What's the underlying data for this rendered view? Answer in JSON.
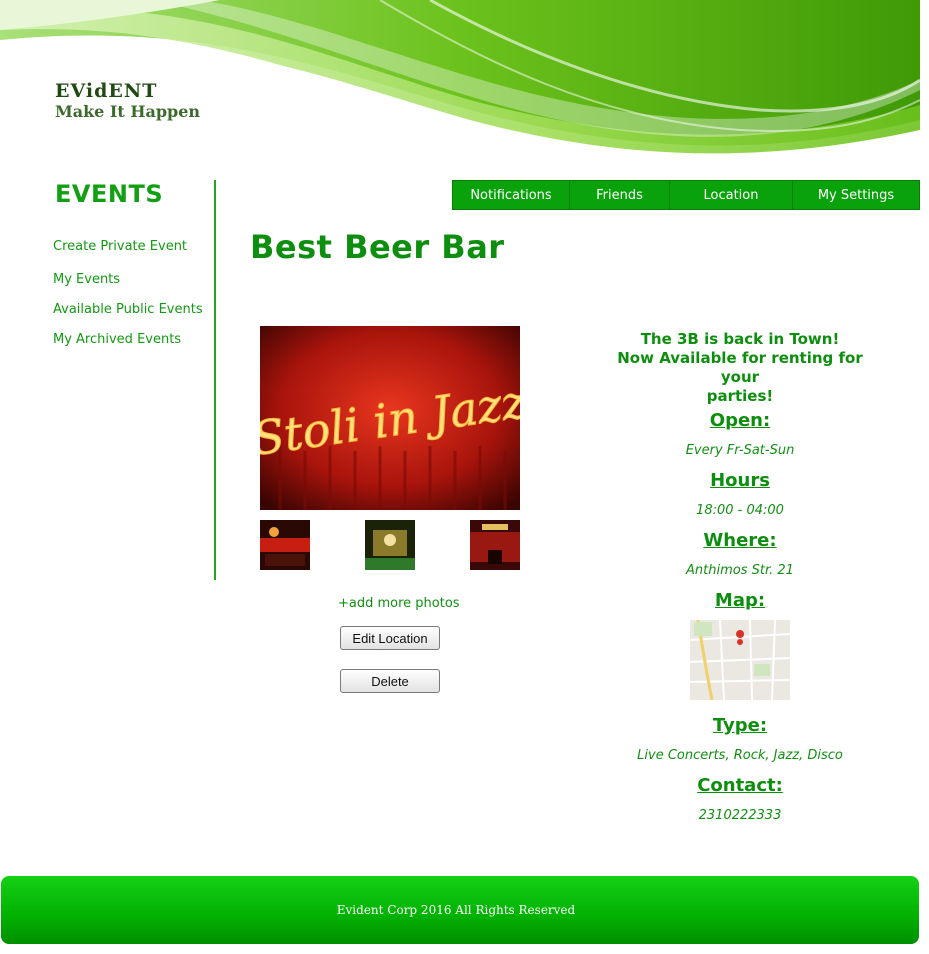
{
  "brand": {
    "name": "EVidENT",
    "tagline": "Make It Happen"
  },
  "sidebar": {
    "title": "EVENTS",
    "items": [
      {
        "label": "Create Private Event"
      },
      {
        "label": "My Events"
      },
      {
        "label": "Available Public Events"
      },
      {
        "label": "My Archived Events"
      }
    ]
  },
  "nav": {
    "items": [
      {
        "label": "Notifications"
      },
      {
        "label": "Friends"
      },
      {
        "label": "Location"
      },
      {
        "label": "My Settings"
      }
    ]
  },
  "event": {
    "title": "Best Beer Bar",
    "main_photo_sign": "Stoli in Jazz",
    "add_photos": "+add more photos",
    "edit_button": "Edit Location",
    "delete_button": "Delete",
    "promo_line1": "The 3B is back in Town!",
    "promo_line2": "Now Available for renting for your",
    "promo_line3": "parties!",
    "open_label": "Open:",
    "open_value": "Every Fr-Sat-Sun",
    "hours_label": "Hours",
    "hours_value": "18:00 - 04:00",
    "where_label": "Where:",
    "where_value": "Anthimos Str. 21",
    "map_label": "Map:",
    "type_label": "Type:",
    "type_value": "Live Concerts, Rock, Jazz, Disco",
    "contact_label": "Contact:",
    "contact_value": "2310222333"
  },
  "footer": {
    "text": "Evident Corp  2016 All Rights Reserved"
  },
  "colors": {
    "accent": "#0aa20a",
    "text_green": "#0e8e0e",
    "footer_green": "#02b002"
  }
}
